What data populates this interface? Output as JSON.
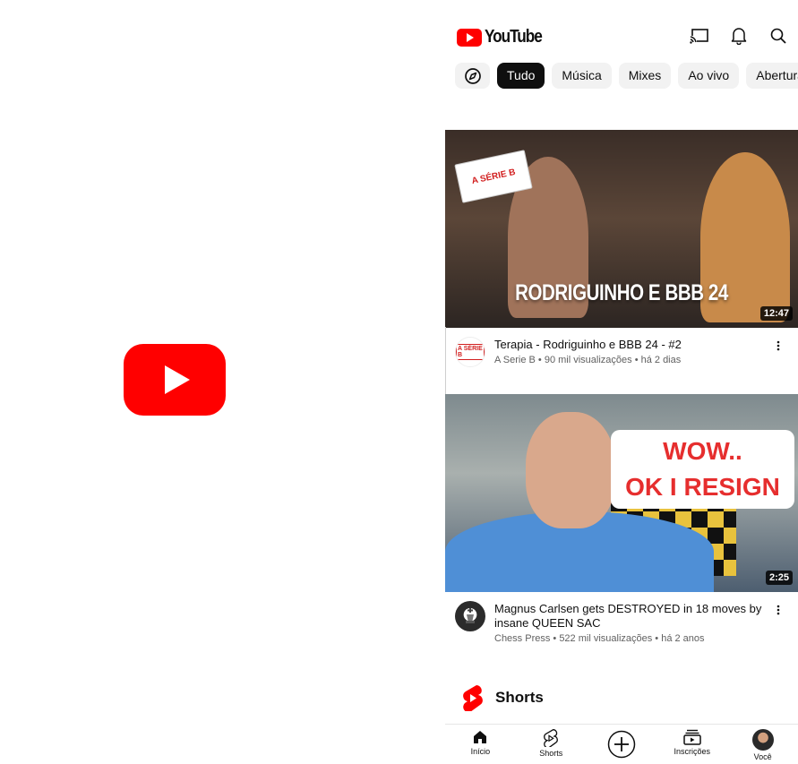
{
  "app": {
    "brand": "YouTube"
  },
  "chips": [
    "Tudo",
    "Música",
    "Mixes",
    "Ao vivo",
    "Aberturas"
  ],
  "videos": [
    {
      "title": "Terapia - Rodriguinho e BBB 24 - #2",
      "subtitle": "A Serie B • 90 mil visualizações • há 2 dias",
      "duration": "12:47",
      "thumb_caption": "RODRIGUINHO E BBB 24",
      "sign_text": "A SÉRIE B",
      "avatar_text": "A SÉRIE B"
    },
    {
      "title": "Magnus Carlsen gets DESTROYED in 18 moves by insane QUEEN SAC",
      "subtitle": "Chess Press • 522 mil visualizações • há 2 anos",
      "duration": "2:25",
      "overlay_line1": "WOW..",
      "overlay_line2": "OK I RESIGN"
    }
  ],
  "shorts": {
    "title": "Shorts"
  },
  "nav": [
    "Início",
    "Shorts",
    "",
    "Inscrições",
    "Você"
  ],
  "colors": {
    "brand_red": "#ff0000",
    "text": "#0f0f0f",
    "secondary": "#606060",
    "chip_bg": "#f2f2f2"
  }
}
